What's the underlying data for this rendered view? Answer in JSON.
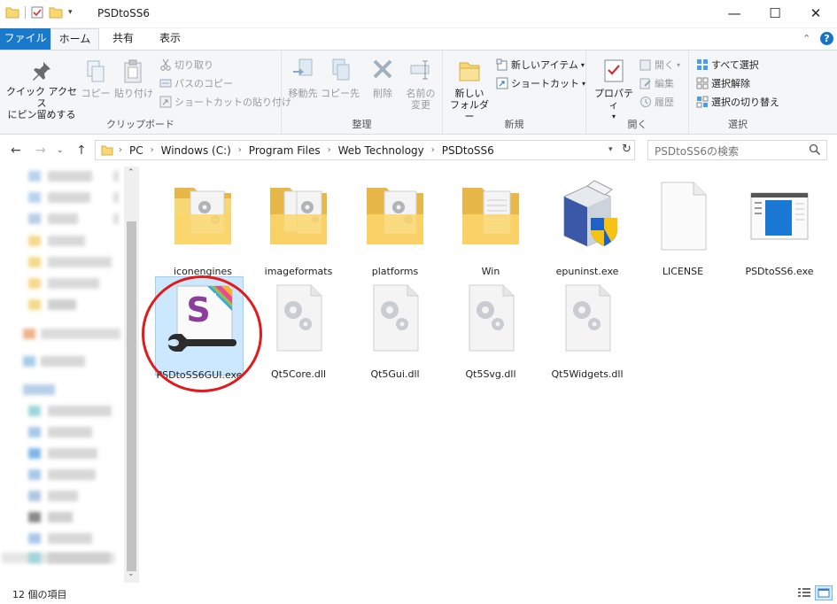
{
  "window": {
    "title": "PSDtoSS6",
    "minimize": "—",
    "maximize": "☐",
    "close": "✕"
  },
  "tabs": {
    "file": "ファイル",
    "home": "ホーム",
    "share": "共有",
    "view": "表示"
  },
  "ribbon": {
    "clipboard": {
      "label": "クリップボード",
      "pin_line1": "クイック アクセス",
      "pin_line2": "にピン留めする",
      "copy": "コピー",
      "paste": "貼り付け",
      "cut": "切り取り",
      "copy_path": "パスのコピー",
      "paste_shortcut": "ショートカットの貼り付け"
    },
    "organize": {
      "label": "整理",
      "move_to": "移動先",
      "copy_to": "コピー先",
      "delete": "削除",
      "rename_line1": "名前の",
      "rename_line2": "変更"
    },
    "new": {
      "label": "新規",
      "new_folder_line1": "新しい",
      "new_folder_line2": "フォルダー",
      "new_item": "新しいアイテム",
      "shortcut": "ショートカット"
    },
    "open": {
      "label": "開く",
      "properties": "プロパティ",
      "open": "開く",
      "edit": "編集",
      "history": "履歴"
    },
    "select": {
      "label": "選択",
      "select_all": "すべて選択",
      "select_none": "選択解除",
      "invert": "選択の切り替え"
    }
  },
  "address": {
    "crumbs": [
      "PC",
      "Windows (C:)",
      "Program Files",
      "Web Technology",
      "PSDtoSS6"
    ],
    "search_placeholder": "PSDtoSS6の検索"
  },
  "files": [
    {
      "name": "iconengines",
      "type": "folder"
    },
    {
      "name": "imageformats",
      "type": "folder"
    },
    {
      "name": "platforms",
      "type": "folder"
    },
    {
      "name": "Win",
      "type": "folder"
    },
    {
      "name": "epuninst.exe",
      "type": "installer"
    },
    {
      "name": "LICENSE",
      "type": "file"
    },
    {
      "name": "PSDtoSS6.exe",
      "type": "app"
    },
    {
      "name": "PSDtoSS6GUI.exe",
      "type": "ss-app",
      "selected": true
    },
    {
      "name": "Qt5Core.dll",
      "type": "dll"
    },
    {
      "name": "Qt5Gui.dll",
      "type": "dll"
    },
    {
      "name": "Qt5Svg.dll",
      "type": "dll"
    },
    {
      "name": "Qt5Widgets.dll",
      "type": "dll"
    }
  ],
  "status": {
    "count": "12 個の項目"
  },
  "colors": {
    "accent": "#1979ca",
    "selection": "#cce8ff",
    "annotation": "#e21a1a",
    "folder": "#f8d775"
  }
}
